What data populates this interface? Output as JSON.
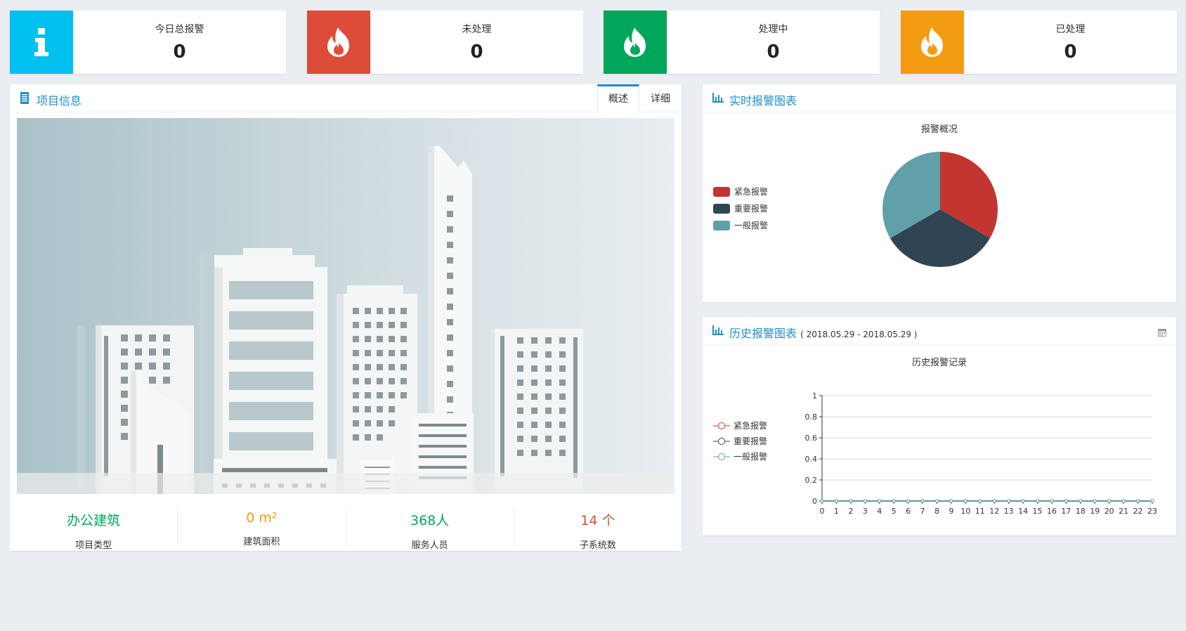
{
  "stats": [
    {
      "label": "今日总报警",
      "value": "0",
      "color": "#00c0ef",
      "icon": "info-icon"
    },
    {
      "label": "未处理",
      "value": "0",
      "color": "#dd4b39",
      "icon": "fire-icon"
    },
    {
      "label": "处理中",
      "value": "0",
      "color": "#00a65a",
      "icon": "fire-icon"
    },
    {
      "label": "已处理",
      "value": "0",
      "color": "#f39c12",
      "icon": "fire-icon"
    }
  ],
  "project": {
    "title": "项目信息",
    "tabs": [
      "概述",
      "详细"
    ],
    "active_tab": "概述",
    "info": [
      {
        "value": "办公建筑",
        "caption": "项目类型",
        "color": "#00a65a"
      },
      {
        "value": "0 m²",
        "caption": "建筑面积",
        "color": "#f39c12"
      },
      {
        "value": "368人",
        "caption": "服务人员",
        "color": "#00a65a"
      },
      {
        "value": "14 个",
        "caption": "子系统数",
        "color": "#dd4b39"
      }
    ]
  },
  "realtime": {
    "title": "实时报警图表",
    "chart_title": "报警概况",
    "legend": [
      {
        "name": "紧急报警",
        "color": "#c23531"
      },
      {
        "name": "重要报警",
        "color": "#2f4554"
      },
      {
        "name": "一般报警",
        "color": "#61a0a8"
      }
    ]
  },
  "history": {
    "title": "历史报警图表",
    "range": "( 2018.05.29 - 2018.05.29 )",
    "chart_title": "历史报警记录",
    "legend": [
      {
        "name": "紧急报警",
        "color": "#c23531"
      },
      {
        "name": "重要报警",
        "color": "#2f4554"
      },
      {
        "name": "一般报警",
        "color": "#61a0a8"
      }
    ]
  },
  "chart_data": [
    {
      "type": "pie",
      "title": "报警概况",
      "labels": [
        "紧急报警",
        "重要报警",
        "一般报警"
      ],
      "values": [
        1,
        1,
        1
      ],
      "colors": [
        "#c23531",
        "#2f4554",
        "#61a0a8"
      ],
      "legend": "left"
    },
    {
      "type": "line",
      "title": "历史报警记录",
      "x": [
        0,
        1,
        2,
        3,
        4,
        5,
        6,
        7,
        8,
        9,
        10,
        11,
        12,
        13,
        14,
        15,
        16,
        17,
        18,
        19,
        20,
        21,
        22,
        23
      ],
      "ylim": [
        0,
        1
      ],
      "yticks": [
        "0",
        "0.2",
        "0.4",
        "0.6",
        "0.8",
        "1"
      ],
      "series": [
        {
          "name": "紧急报警",
          "color": "#c23531",
          "values": [
            0,
            0,
            0,
            0,
            0,
            0,
            0,
            0,
            0,
            0,
            0,
            0,
            0,
            0,
            0,
            0,
            0,
            0,
            0,
            0,
            0,
            0,
            0,
            0
          ]
        },
        {
          "name": "重要报警",
          "color": "#2f4554",
          "values": [
            0,
            0,
            0,
            0,
            0,
            0,
            0,
            0,
            0,
            0,
            0,
            0,
            0,
            0,
            0,
            0,
            0,
            0,
            0,
            0,
            0,
            0,
            0,
            0
          ]
        },
        {
          "name": "一般报警",
          "color": "#61a0a8",
          "values": [
            0,
            0,
            0,
            0,
            0,
            0,
            0,
            0,
            0,
            0,
            0,
            0,
            0,
            0,
            0,
            0,
            0,
            0,
            0,
            0,
            0,
            0,
            0,
            0
          ]
        }
      ],
      "grid": true,
      "legend": "left"
    }
  ]
}
